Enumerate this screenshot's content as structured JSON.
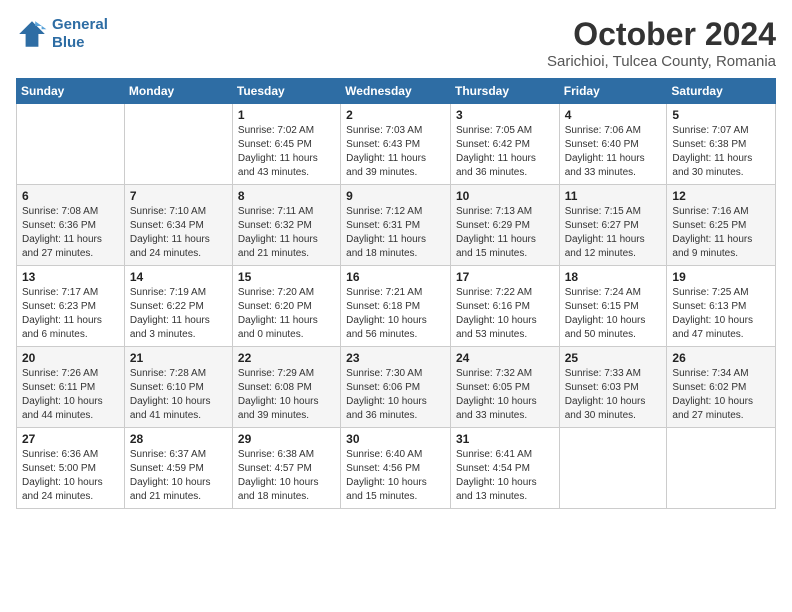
{
  "logo": {
    "line1": "General",
    "line2": "Blue"
  },
  "header": {
    "month": "October 2024",
    "location": "Sarichioi, Tulcea County, Romania"
  },
  "weekdays": [
    "Sunday",
    "Monday",
    "Tuesday",
    "Wednesday",
    "Thursday",
    "Friday",
    "Saturday"
  ],
  "weeks": [
    [
      {
        "day": "",
        "detail": ""
      },
      {
        "day": "",
        "detail": ""
      },
      {
        "day": "1",
        "detail": "Sunrise: 7:02 AM\nSunset: 6:45 PM\nDaylight: 11 hours and 43 minutes."
      },
      {
        "day": "2",
        "detail": "Sunrise: 7:03 AM\nSunset: 6:43 PM\nDaylight: 11 hours and 39 minutes."
      },
      {
        "day": "3",
        "detail": "Sunrise: 7:05 AM\nSunset: 6:42 PM\nDaylight: 11 hours and 36 minutes."
      },
      {
        "day": "4",
        "detail": "Sunrise: 7:06 AM\nSunset: 6:40 PM\nDaylight: 11 hours and 33 minutes."
      },
      {
        "day": "5",
        "detail": "Sunrise: 7:07 AM\nSunset: 6:38 PM\nDaylight: 11 hours and 30 minutes."
      }
    ],
    [
      {
        "day": "6",
        "detail": "Sunrise: 7:08 AM\nSunset: 6:36 PM\nDaylight: 11 hours and 27 minutes."
      },
      {
        "day": "7",
        "detail": "Sunrise: 7:10 AM\nSunset: 6:34 PM\nDaylight: 11 hours and 24 minutes."
      },
      {
        "day": "8",
        "detail": "Sunrise: 7:11 AM\nSunset: 6:32 PM\nDaylight: 11 hours and 21 minutes."
      },
      {
        "day": "9",
        "detail": "Sunrise: 7:12 AM\nSunset: 6:31 PM\nDaylight: 11 hours and 18 minutes."
      },
      {
        "day": "10",
        "detail": "Sunrise: 7:13 AM\nSunset: 6:29 PM\nDaylight: 11 hours and 15 minutes."
      },
      {
        "day": "11",
        "detail": "Sunrise: 7:15 AM\nSunset: 6:27 PM\nDaylight: 11 hours and 12 minutes."
      },
      {
        "day": "12",
        "detail": "Sunrise: 7:16 AM\nSunset: 6:25 PM\nDaylight: 11 hours and 9 minutes."
      }
    ],
    [
      {
        "day": "13",
        "detail": "Sunrise: 7:17 AM\nSunset: 6:23 PM\nDaylight: 11 hours and 6 minutes."
      },
      {
        "day": "14",
        "detail": "Sunrise: 7:19 AM\nSunset: 6:22 PM\nDaylight: 11 hours and 3 minutes."
      },
      {
        "day": "15",
        "detail": "Sunrise: 7:20 AM\nSunset: 6:20 PM\nDaylight: 11 hours and 0 minutes."
      },
      {
        "day": "16",
        "detail": "Sunrise: 7:21 AM\nSunset: 6:18 PM\nDaylight: 10 hours and 56 minutes."
      },
      {
        "day": "17",
        "detail": "Sunrise: 7:22 AM\nSunset: 6:16 PM\nDaylight: 10 hours and 53 minutes."
      },
      {
        "day": "18",
        "detail": "Sunrise: 7:24 AM\nSunset: 6:15 PM\nDaylight: 10 hours and 50 minutes."
      },
      {
        "day": "19",
        "detail": "Sunrise: 7:25 AM\nSunset: 6:13 PM\nDaylight: 10 hours and 47 minutes."
      }
    ],
    [
      {
        "day": "20",
        "detail": "Sunrise: 7:26 AM\nSunset: 6:11 PM\nDaylight: 10 hours and 44 minutes."
      },
      {
        "day": "21",
        "detail": "Sunrise: 7:28 AM\nSunset: 6:10 PM\nDaylight: 10 hours and 41 minutes."
      },
      {
        "day": "22",
        "detail": "Sunrise: 7:29 AM\nSunset: 6:08 PM\nDaylight: 10 hours and 39 minutes."
      },
      {
        "day": "23",
        "detail": "Sunrise: 7:30 AM\nSunset: 6:06 PM\nDaylight: 10 hours and 36 minutes."
      },
      {
        "day": "24",
        "detail": "Sunrise: 7:32 AM\nSunset: 6:05 PM\nDaylight: 10 hours and 33 minutes."
      },
      {
        "day": "25",
        "detail": "Sunrise: 7:33 AM\nSunset: 6:03 PM\nDaylight: 10 hours and 30 minutes."
      },
      {
        "day": "26",
        "detail": "Sunrise: 7:34 AM\nSunset: 6:02 PM\nDaylight: 10 hours and 27 minutes."
      }
    ],
    [
      {
        "day": "27",
        "detail": "Sunrise: 6:36 AM\nSunset: 5:00 PM\nDaylight: 10 hours and 24 minutes."
      },
      {
        "day": "28",
        "detail": "Sunrise: 6:37 AM\nSunset: 4:59 PM\nDaylight: 10 hours and 21 minutes."
      },
      {
        "day": "29",
        "detail": "Sunrise: 6:38 AM\nSunset: 4:57 PM\nDaylight: 10 hours and 18 minutes."
      },
      {
        "day": "30",
        "detail": "Sunrise: 6:40 AM\nSunset: 4:56 PM\nDaylight: 10 hours and 15 minutes."
      },
      {
        "day": "31",
        "detail": "Sunrise: 6:41 AM\nSunset: 4:54 PM\nDaylight: 10 hours and 13 minutes."
      },
      {
        "day": "",
        "detail": ""
      },
      {
        "day": "",
        "detail": ""
      }
    ]
  ]
}
